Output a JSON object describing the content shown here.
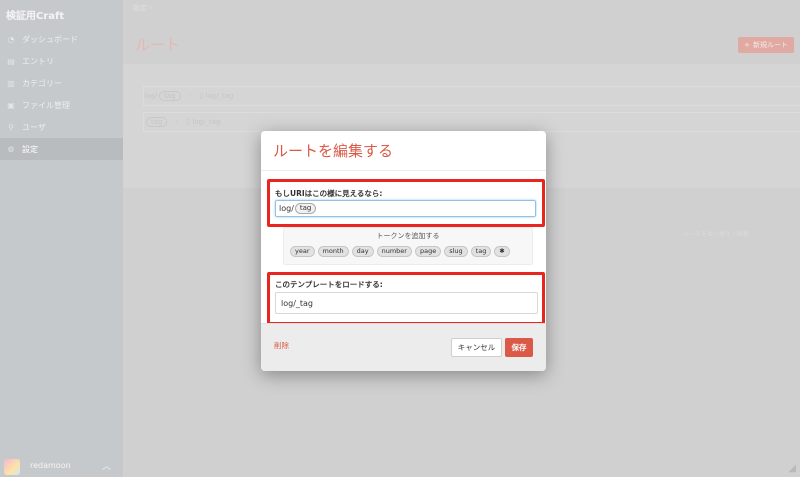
{
  "sidebar": {
    "site_name": "検証用Craft",
    "items": [
      {
        "label": "ダッシュボード",
        "icon": "dashboard-icon",
        "glyph": "◔"
      },
      {
        "label": "エントリ",
        "icon": "entries-icon",
        "glyph": "▤"
      },
      {
        "label": "カテゴリー",
        "icon": "categories-icon",
        "glyph": "▥"
      },
      {
        "label": "ファイル管理",
        "icon": "assets-icon",
        "glyph": "▣"
      },
      {
        "label": "ユーザ",
        "icon": "users-icon",
        "glyph": "⚲"
      },
      {
        "label": "設定",
        "icon": "settings-gear-icon",
        "glyph": "⚙",
        "active": true
      }
    ],
    "user": {
      "name": "redamoon"
    }
  },
  "main": {
    "breadcrumb": "設定 ›",
    "title": "ルート",
    "new_route_label": "新規ルート",
    "routes": [
      {
        "uri_prefix": "log/",
        "uri_token": "tag",
        "template": "log/_tag"
      },
      {
        "uri_prefix": "",
        "uri_token": "tag",
        "template": "log/_tag"
      }
    ],
    "helper_text": "ルートを並べ替え・編集"
  },
  "modal": {
    "title": "ルートを編集する",
    "uri_label": "もしURIはこの様に見えるなら:",
    "uri_prefix": "log/",
    "uri_token": "tag",
    "tokens_label": "トークンを追加する",
    "tokens": [
      "year",
      "month",
      "day",
      "number",
      "page",
      "slug",
      "tag",
      "✱"
    ],
    "template_label": "このテンプレートをロードする:",
    "template_value": "log/_tag",
    "delete_label": "削除",
    "cancel_label": "キャンセル",
    "save_label": "保存"
  },
  "colors": {
    "accent": "#da5a47",
    "highlight": "#e8261d",
    "sidebar": "#c6c9cc"
  }
}
